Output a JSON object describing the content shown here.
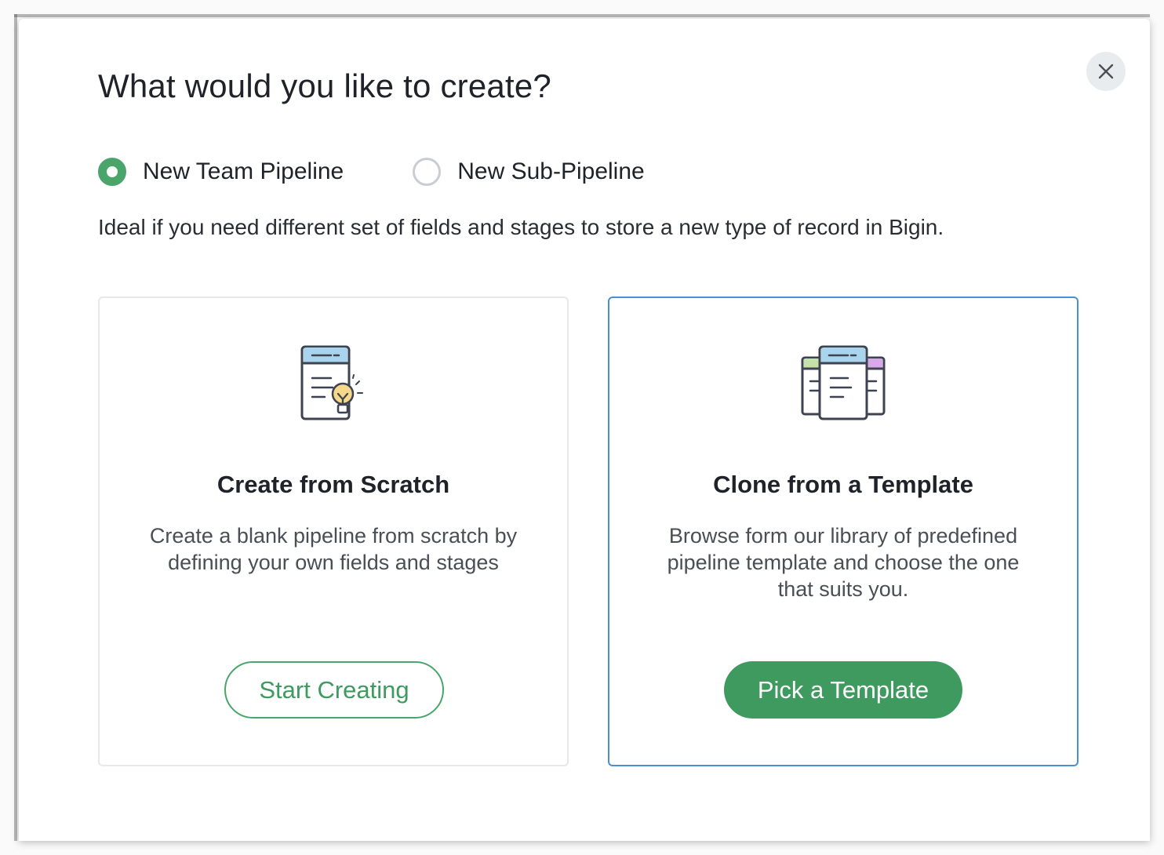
{
  "modal": {
    "title": "What would you like to create?",
    "close_icon": "close-icon"
  },
  "options": {
    "team_pipeline": {
      "label": "New Team Pipeline",
      "checked": true
    },
    "sub_pipeline": {
      "label": "New Sub-Pipeline",
      "checked": false
    }
  },
  "description": "Ideal if you need different set of fields and stages to store a new type of record in Bigin.",
  "cards": {
    "scratch": {
      "icon": "document-lightbulb-icon",
      "title": "Create from Scratch",
      "description": "Create a blank pipeline from scratch by defining your own fields and stages",
      "button_label": "Start Creating"
    },
    "template": {
      "icon": "stacked-documents-icon",
      "title": "Clone from a Template",
      "description": "Browse form our library of predefined pipeline template and choose the one that suits you.",
      "button_label": "Pick a Template",
      "selected": true
    }
  },
  "colors": {
    "accent_green": "#3f9a5f",
    "selected_border": "#4a8fd6",
    "radio_checked": "#4aa56b"
  }
}
